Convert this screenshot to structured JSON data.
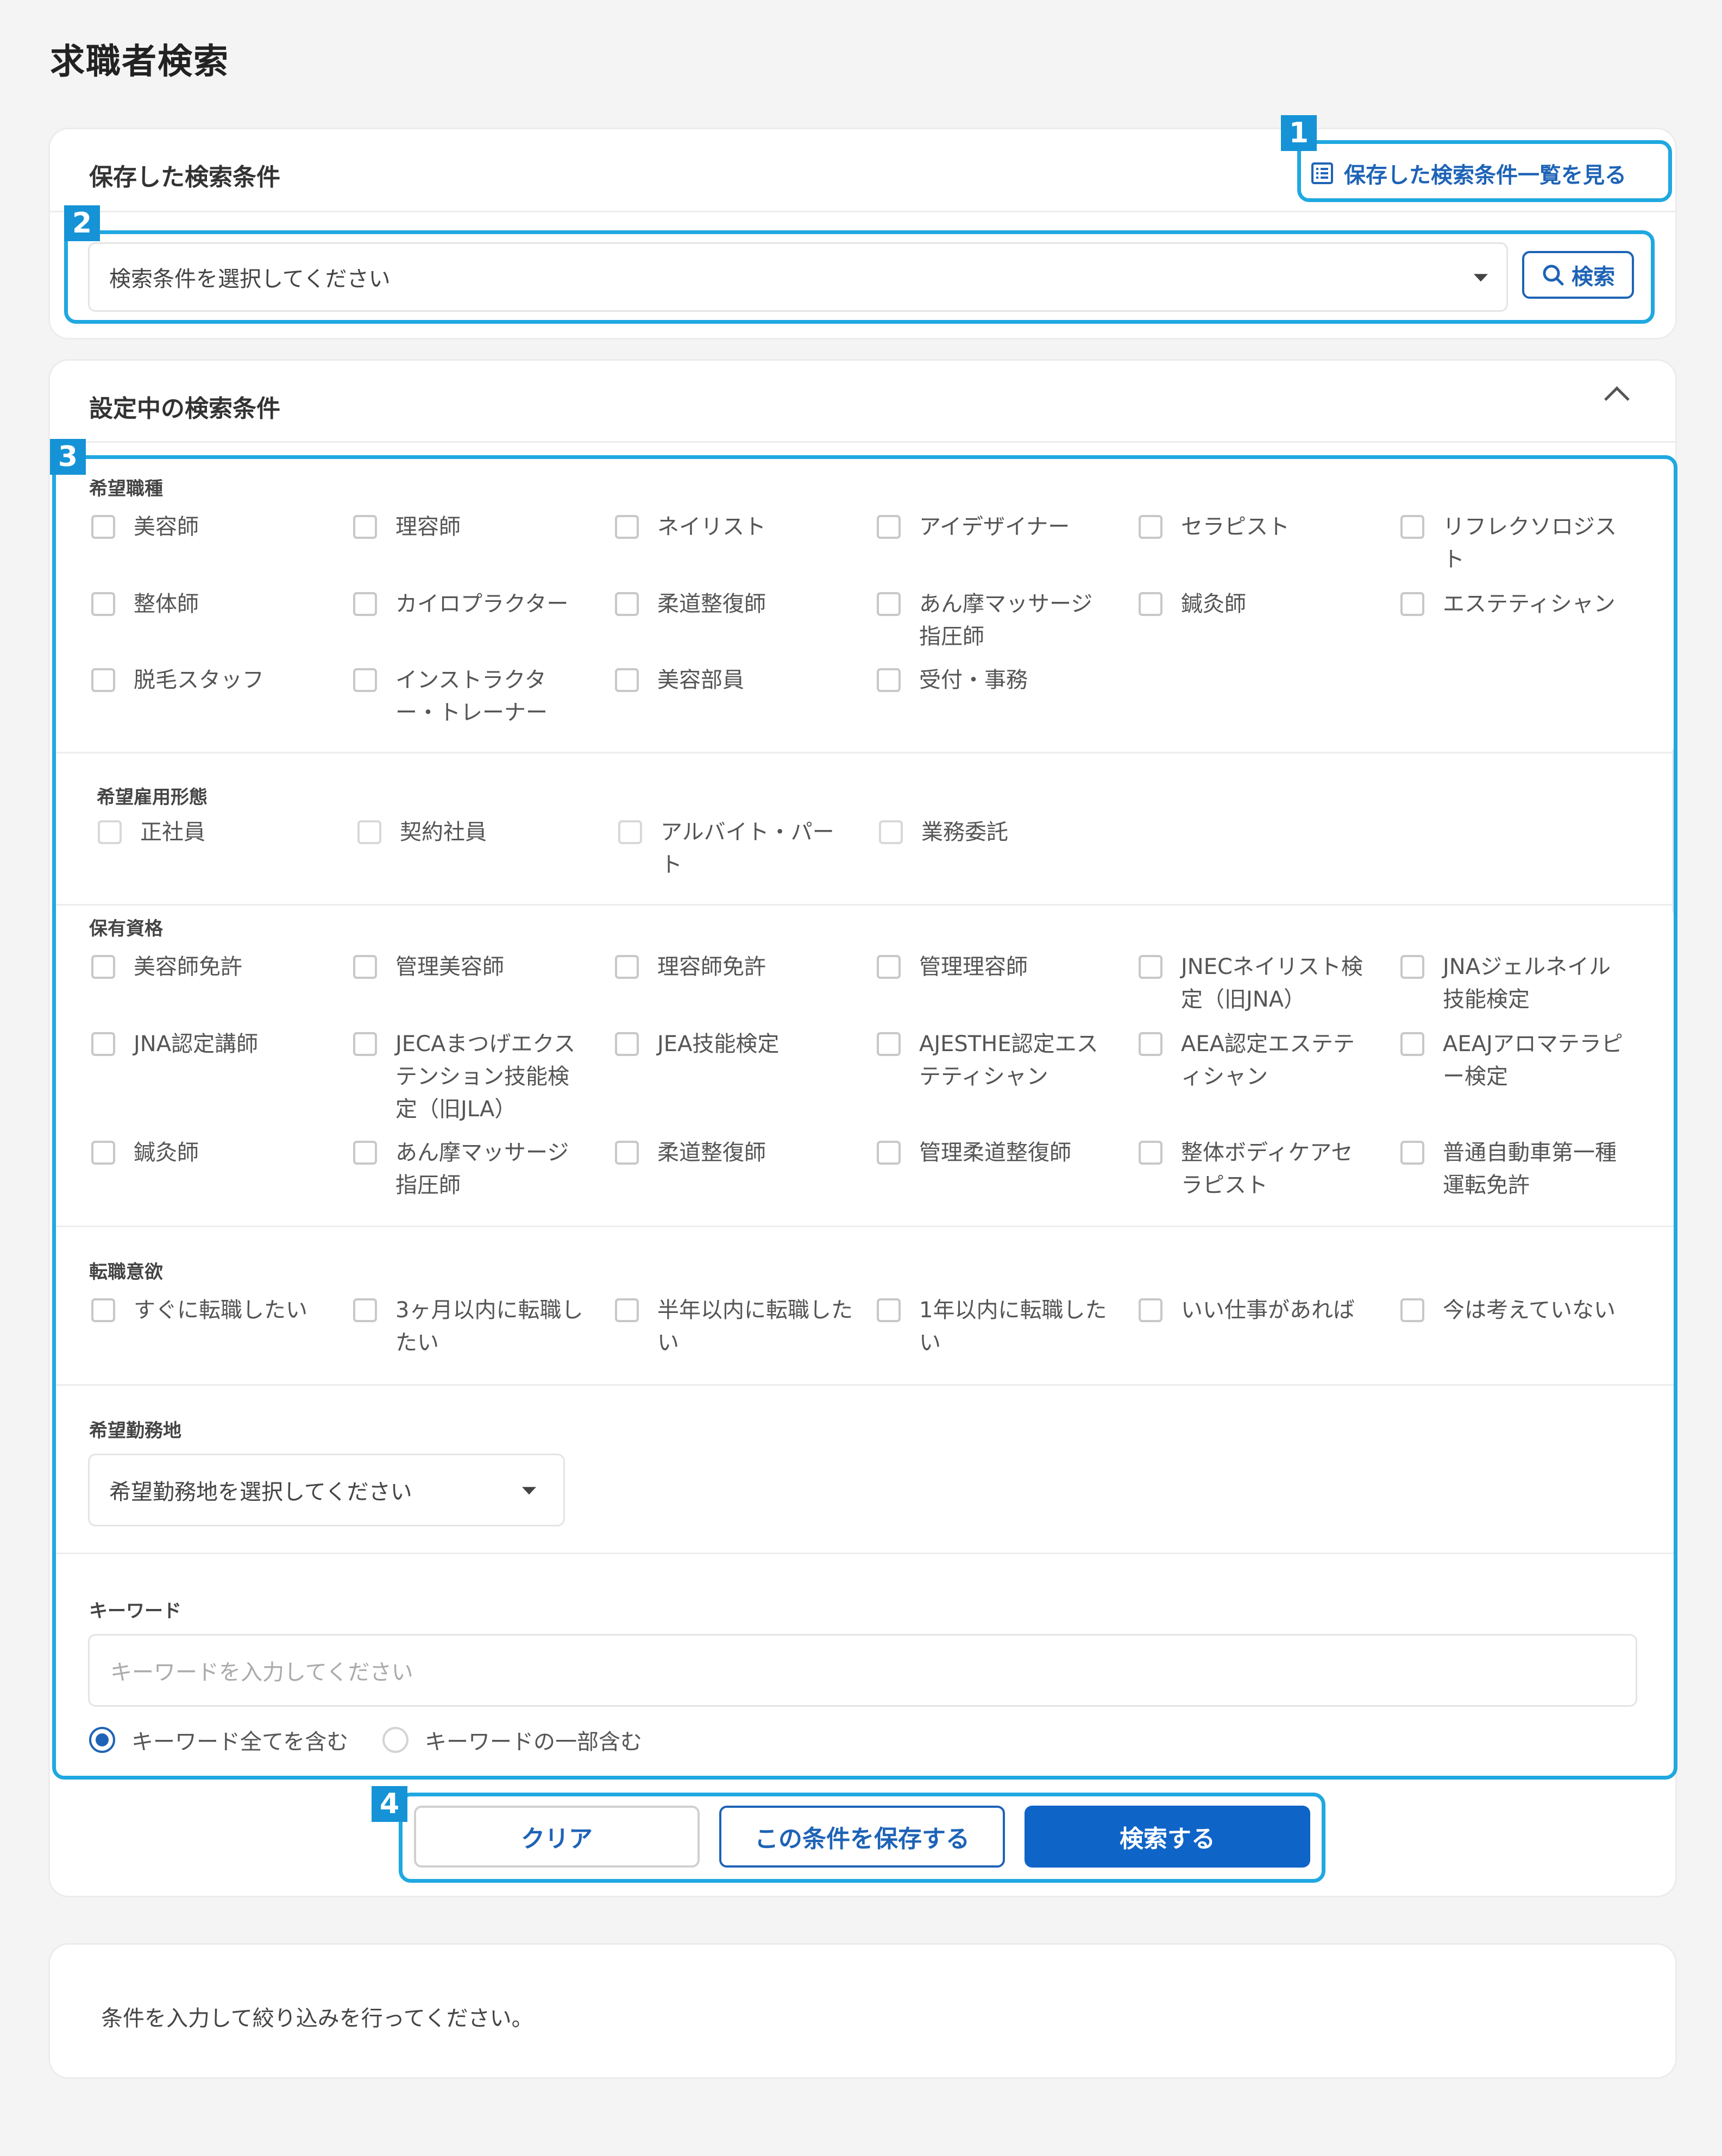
{
  "page_title": "求職者検索",
  "saved": {
    "heading": "保存した検索条件",
    "list_link": "保存した検索条件一覧を見る",
    "select_placeholder": "検索条件を選択してください",
    "search_button": "検索"
  },
  "current": {
    "heading": "設定中の検索条件"
  },
  "badges": [
    "1",
    "2",
    "3",
    "4"
  ],
  "job_types": {
    "label": "希望職種",
    "rows": [
      [
        "美容師",
        "理容師",
        "ネイリスト",
        "アイデザイナー",
        "セラピスト",
        "リフレクソロジスト"
      ],
      [
        "整体師",
        "カイロプラクター",
        "柔道整復師",
        "あん摩マッサージ指圧師",
        "鍼灸師",
        "エステティシャン"
      ],
      [
        "脱毛スタッフ",
        "インストラクター・トレーナー",
        "美容部員",
        "受付・事務"
      ]
    ]
  },
  "employment": {
    "label": "希望雇用形態",
    "items": [
      "正社員",
      "契約社員",
      "アルバイト・パート",
      "業務委託"
    ]
  },
  "qualifications": {
    "label": "保有資格",
    "rows": [
      [
        "美容師免許",
        "管理美容師",
        "理容師免許",
        "管理理容師",
        "JNECネイリスト検定（旧JNA）",
        "JNAジェルネイル技能検定"
      ],
      [
        "JNA認定講師",
        "JECAまつげエクステンション技能検定（旧JLA）",
        "JEA技能検定",
        "AJESTHE認定エステティシャン",
        "AEA認定エステティシャン",
        "AEAJアロマテラピー検定"
      ],
      [
        "鍼灸師",
        "あん摩マッサージ指圧師",
        "柔道整復師",
        "管理柔道整復師",
        "整体ボディケアセラピスト",
        "普通自動車第一種運転免許"
      ]
    ]
  },
  "intent": {
    "label": "転職意欲",
    "items": [
      "すぐに転職したい",
      "3ヶ月以内に転職したい",
      "半年以内に転職したい",
      "1年以内に転職したい",
      "いい仕事があれば",
      "今は考えていない"
    ]
  },
  "location": {
    "label": "希望勤務地",
    "placeholder": "希望勤務地を選択してください"
  },
  "keyword": {
    "label": "キーワード",
    "placeholder": "キーワードを入力してください",
    "radio_all": "キーワード全てを含む",
    "radio_some": "キーワードの一部含む"
  },
  "actions": {
    "clear": "クリア",
    "save": "この条件を保存する",
    "search": "検索する"
  },
  "result_note": "条件を入力して絞り込みを行ってください。",
  "colors": {
    "accent": "#1e63b6",
    "primary_button": "#0f64c8",
    "highlight": "#20a8e0",
    "badge": "#1593d6"
  }
}
